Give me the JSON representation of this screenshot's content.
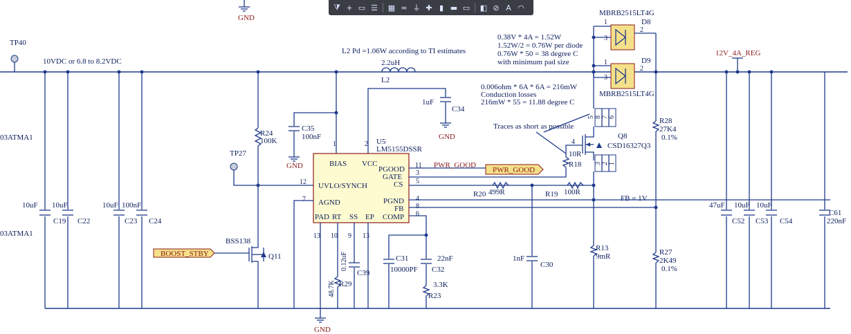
{
  "toolbar": {
    "buttons": [
      {
        "icon": "filter-icon",
        "glyph": "⧩"
      },
      {
        "icon": "crosshair-icon",
        "glyph": "+"
      },
      {
        "icon": "select-rect-icon",
        "glyph": "▭"
      },
      {
        "icon": "align-icon",
        "glyph": "☰"
      },
      {
        "icon": "place-component-icon",
        "glyph": "▦"
      },
      {
        "icon": "bus-icon",
        "glyph": "≈"
      },
      {
        "icon": "power-port-icon",
        "glyph": "⏚"
      },
      {
        "icon": "net-label-icon",
        "glyph": "✚"
      },
      {
        "icon": "port-icon",
        "glyph": "▮"
      },
      {
        "icon": "sheet-symbol-icon",
        "glyph": "▬"
      },
      {
        "icon": "harness-icon",
        "glyph": "▭"
      },
      {
        "icon": "directive-icon",
        "glyph": "◧"
      },
      {
        "icon": "no-erc-icon",
        "glyph": "⊘"
      },
      {
        "icon": "text-icon",
        "glyph": "A"
      },
      {
        "icon": "arc-icon",
        "glyph": "◠"
      }
    ]
  },
  "labels": {
    "gnd_top": "GND",
    "gnd_mid": "GND",
    "gnd_c34": "GND",
    "gnd_bottom": "GND",
    "tp40": "TP40",
    "tp27": "TP27",
    "vin_net": "10VDC or 6.8 to 8.2VDC",
    "part_left_1": "03ATMA1",
    "part_left_2": "03ATMA1",
    "l2_note": "L2 Pd =1.06W according to TI estimates",
    "l2_value": "2.2uH",
    "l2_ref": "L2",
    "d8_part": "MBRB2515LT4G",
    "d8_ref": "D8",
    "d9_ref": "D9",
    "d9_part": "MBRB2515LT4G",
    "diode_note_1": "0.38V * 4A = 1.52W",
    "diode_note_2": "1.52W/2 = 0.76W per diode",
    "diode_note_3": "0.76W * 50 = 38 degree C",
    "diode_note_4": "with minimum pad size",
    "cond_note_1": "0.006ohm * 6A * 6A = 216mW",
    "cond_note_2": "Conduction losses",
    "cond_note_3": "216mW * 55 = 11.88 degree C",
    "traces_note": "Traces as short as possible",
    "vout_net": "12V_4A_REG",
    "c34_val": "1uF",
    "c34_ref": "C34",
    "c35_ref": "C35",
    "c35_val": "100nF",
    "r24_ref": "R24",
    "r24_val": "100K",
    "u5_ref": "U5",
    "u5_part": "LM5155DSSR",
    "pin_bias": "BIAS",
    "pin_vcc": "VCC",
    "pin_pgood": "PGOOD",
    "pin_gate": "GATE",
    "pin_cs": "CS",
    "pin_uvlo": "UVLO/SYNCH",
    "pin_agnd": "AGND",
    "pin_pgnd": "PGND",
    "pin_fb": "FB",
    "pin_pad": "PAD",
    "pin_rt": "RT",
    "pin_ss": "SS",
    "pin_ep": "EP",
    "pin_comp": "COMP",
    "pn_1": "1",
    "pn_2": "2",
    "pn_11": "11",
    "pn_3": "3",
    "pn_5": "5",
    "pn_12": "12",
    "pn_7": "7",
    "pn_4": "4",
    "pn_8": "8",
    "pn_6": "6",
    "pn_13a": "13",
    "pn_10": "10",
    "pn_9": "9",
    "pn_13b": "13",
    "pwr_good_net": "PWR_GOOD",
    "pwr_good_port": "PWR_GOOD",
    "boost_stby": "BOOST_STBY",
    "bss138": "BSS138",
    "q11": "Q11",
    "q8_ref": "Q8",
    "q8_part": "CSD16327Q3",
    "r18_val": "10R",
    "r18_ref": "R18",
    "r20_ref": "R20",
    "r20_val": "499R",
    "r19_ref": "R19",
    "r19_val": "100R",
    "fb_note": "FB = 1V",
    "r28_ref": "R28",
    "r28_val": "27K4",
    "r28_tol": "0.1%",
    "r27_ref": "R27",
    "r27_val": "2K49",
    "r27_tol": "0.1%",
    "r13_ref": "R13",
    "r13_val": "9mR",
    "c30_val": "1nF",
    "c30_ref": "C30",
    "c31_ref": "C31",
    "c31_val": "10000PF",
    "c32_val": "22nF",
    "c32_ref": "C32",
    "r23_val": "3.3K",
    "r23_ref": "R23",
    "c39_ref": "C39",
    "c39_val": "0.12uF",
    "r29_val": "48.7K",
    "r29_ref": "R29",
    "c19_val": "10uF",
    "c19_ref": "C19",
    "c22_val": "10uF",
    "c22_ref": "C22",
    "c23_val": "10uF",
    "c23_ref": "C23",
    "c24_val": "100nF",
    "c24_ref": "C24",
    "c52_val": "47uF",
    "c52_ref": "C52",
    "c53_val": "10uF",
    "c53_ref": "C53",
    "c54_val": "10uF",
    "c54_ref": "C54",
    "c61_ref": "C61",
    "c61_val": "220nF",
    "q8_pin8": "8",
    "q8_pin7": "7",
    "q8_pin6": "6",
    "q8_pin5": "5",
    "q8_pin3": "3",
    "q8_pin2": "2",
    "q8_pin1": "1",
    "q8_pin4": "4",
    "d8_pin1": "1",
    "d8_pin3": "3",
    "d8_pin2": "2",
    "d9_pin1": "1",
    "d9_pin3": "3",
    "d9_pin2": "2"
  }
}
